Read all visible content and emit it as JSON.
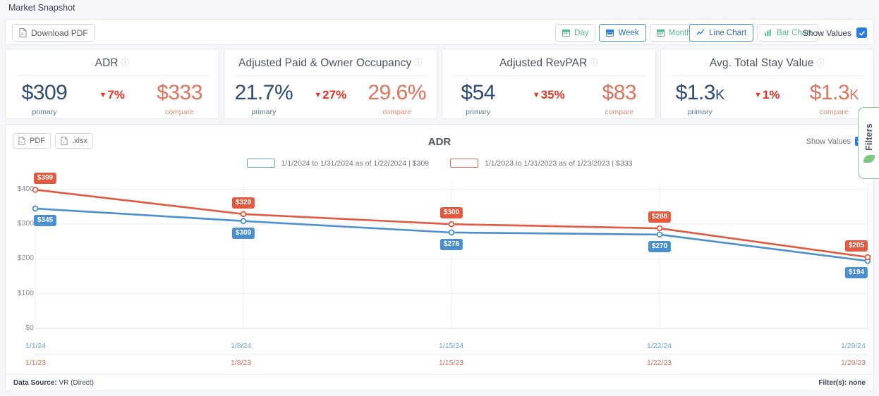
{
  "page": {
    "title": "Market Snapshot"
  },
  "toolbar": {
    "download_pdf": "Download PDF",
    "download_pdf_icon": "file-pdf-icon",
    "date_buttons": [
      {
        "label": "Day",
        "icon": "calendar-icon",
        "active": false
      },
      {
        "label": "Week",
        "icon": "calendar-icon",
        "active": true
      },
      {
        "label": "Month",
        "icon": "calendar-icon",
        "active": false
      }
    ],
    "chart_buttons": [
      {
        "label": "Line Chart",
        "icon": "line-chart-icon",
        "active": true
      },
      {
        "label": "Bar Chart",
        "icon": "bar-chart-icon",
        "active": false
      }
    ],
    "show_values_label": "Show Values",
    "show_values_checked": true,
    "accent_blue": "#2a7ee0",
    "accent_green": "#57b894"
  },
  "kpis": [
    {
      "title": "ADR",
      "info_icon": "info-icon",
      "primary_value": "$309",
      "primary_label": "primary",
      "delta": "7%",
      "delta_direction": "down",
      "compare_value": "$333",
      "compare_label": "compare"
    },
    {
      "title": "Adjusted Paid & Owner Occupancy",
      "info_icon": "info-icon",
      "primary_value": "21.7%",
      "primary_label": "primary",
      "delta": "27%",
      "delta_direction": "down",
      "compare_value": "29.6%",
      "compare_label": "compare"
    },
    {
      "title": "Adjusted RevPAR",
      "info_icon": "info-icon",
      "primary_value": "$54",
      "primary_label": "primary",
      "delta": "35%",
      "delta_direction": "down",
      "compare_value": "$83",
      "compare_label": "compare"
    },
    {
      "title": "Avg. Total Stay Value",
      "info_icon": "info-icon",
      "primary_value": "$1.3",
      "primary_suffix": "K",
      "primary_label": "primary",
      "delta": "1%",
      "delta_direction": "down",
      "compare_value": "$1.3",
      "compare_suffix": "K",
      "compare_label": "compare"
    }
  ],
  "panel": {
    "export_buttons": [
      {
        "label": "PDF",
        "icon": "file-pdf-icon"
      },
      {
        "label": ".xlsx",
        "icon": "file-xlsx-icon"
      }
    ],
    "show_values_label": "Show Values",
    "show_values_checked": true,
    "footer_source_label": "Data Source:",
    "footer_source_value": "VR (Direct)",
    "footer_filters": "Filter(s): none"
  },
  "filters_tab": {
    "label": "Filters",
    "icon": "leaf-icon"
  },
  "chart_data": {
    "type": "line",
    "title": "ADR",
    "xlabel": "",
    "ylabel": "",
    "ylim": [
      0,
      420
    ],
    "yticks": [
      "$0",
      "$100",
      "$200",
      "$300",
      "$400"
    ],
    "ytick_values": [
      0,
      100,
      200,
      300,
      400
    ],
    "grid": true,
    "legend_position": "top-center",
    "x_primary": [
      "1/1/24",
      "1/8/24",
      "1/15/24",
      "1/22/24",
      "1/29/24"
    ],
    "x_compare": [
      "1/1/23",
      "1/8/23",
      "1/15/23",
      "1/22/23",
      "1/29/23"
    ],
    "series": [
      {
        "name": "1/1/2024 to 1/31/2024 as of 1/22/2024 | $309",
        "short_name": "primary",
        "color": "#4a8fd0",
        "values": [
          345,
          309,
          276,
          270,
          194
        ],
        "labels": [
          "$345",
          "$309",
          "$276",
          "$270",
          "$194"
        ],
        "label_positions": [
          "below",
          "below",
          "below",
          "below",
          "below"
        ]
      },
      {
        "name": "1/1/2023 to 1/31/2023 as of 1/23/2023 | $333",
        "short_name": "compare",
        "color": "#e2593f",
        "values": [
          399,
          329,
          300,
          288,
          205
        ],
        "labels": [
          "$399",
          "$329",
          "$300",
          "$288",
          "$205"
        ],
        "label_positions": [
          "above",
          "above",
          "above",
          "above",
          "above"
        ]
      }
    ]
  }
}
